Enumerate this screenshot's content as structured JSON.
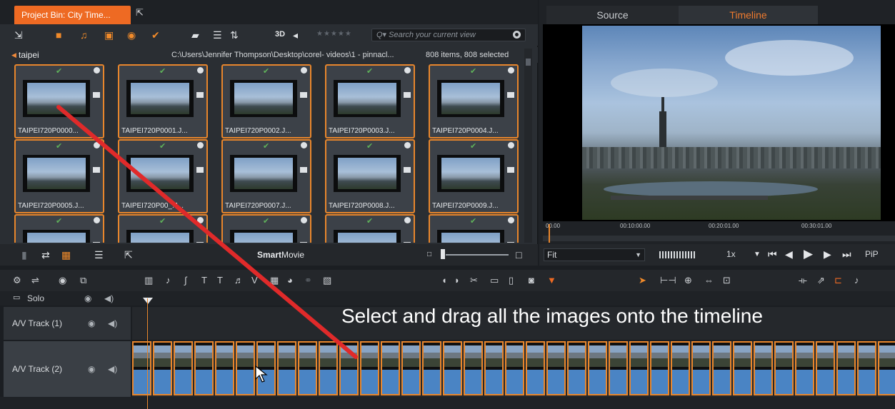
{
  "bin": {
    "tab_label": "Project Bin: City Time...",
    "toolbar_3d": "3D",
    "rating": "★★★★★",
    "search_placeholder": "Search your current view",
    "folder_name": "taipei",
    "folder_path": "C:\\Users\\Jennifer Thompson\\Desktop\\corel- videos\\1 - pinnacl...",
    "item_count": "808 items, 808 selected",
    "tiles": [
      "TAIPEI720P0000...",
      "TAIPEI720P0001.J...",
      "TAIPEI720P0002.J...",
      "TAIPEI720P0003.J...",
      "TAIPEI720P0004.J...",
      "TAIPEI720P0005.J...",
      "TAIPEI720P00_.J...",
      "TAIPEI720P0007.J...",
      "TAIPEI720P0008.J...",
      "TAIPEI720P0009.J...",
      "",
      "",
      "",
      "",
      ""
    ],
    "smartmovie_bold": "Smart",
    "smartmovie_rest": "Movie"
  },
  "player": {
    "tab_source": "Source",
    "tab_timeline": "Timeline",
    "ruler_marks": [
      "00.00",
      "00:10:00.00",
      "00:20:01.00",
      "00:30:01.00"
    ],
    "fit_label": "Fit",
    "speed_label": "1x",
    "pip_label": "PiP"
  },
  "timeline": {
    "solo_label": "Solo",
    "tracks": [
      {
        "name": "A/V Track (1)"
      },
      {
        "name": "A/V Track (2)"
      }
    ],
    "caption": "Select and drag all the images onto the timeline",
    "clip_count": 37
  },
  "colors": {
    "accent": "#ee6a23",
    "clip_border": "#e8862c",
    "clip_fill": "#4a84c4",
    "drag_arrow": "#e02a2a"
  }
}
